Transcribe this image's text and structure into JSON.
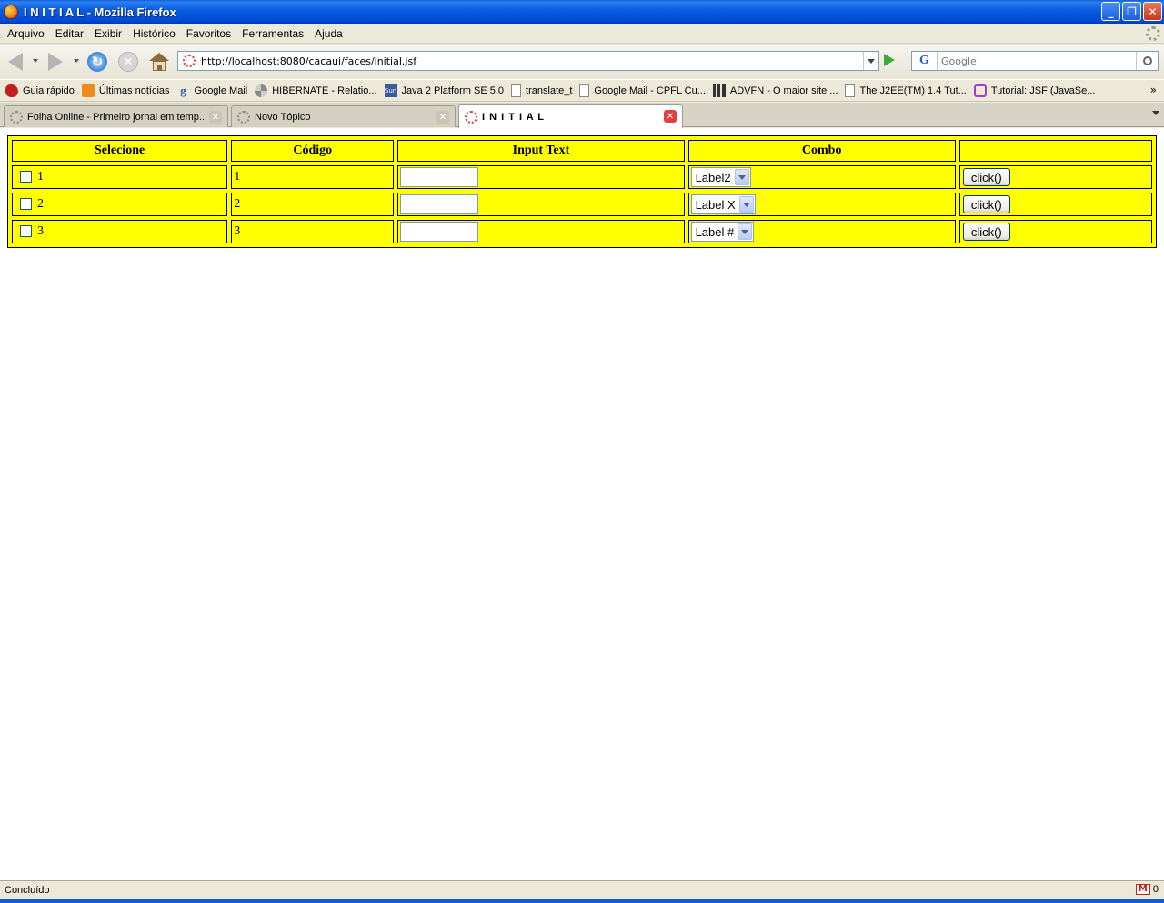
{
  "window": {
    "title": "I N I T I A L - Mozilla Firefox",
    "buttons": {
      "minimize": "_",
      "maximize": "❐",
      "close": "✕"
    }
  },
  "menu": {
    "items": [
      "Arquivo",
      "Editar",
      "Exibir",
      "Histórico",
      "Favoritos",
      "Ferramentas",
      "Ajuda"
    ]
  },
  "nav": {
    "url": "http://localhost:8080/cacaui/faces/initial.jsf",
    "search_placeholder": "Google",
    "search_engine": "G"
  },
  "bookmarks": [
    {
      "label": "Guia rápido",
      "icon": "red-hat-icon"
    },
    {
      "label": "Últimas notícias",
      "icon": "rss-icon"
    },
    {
      "label": "Google Mail",
      "icon": "google-icon"
    },
    {
      "label": "HIBERNATE - Relatio...",
      "icon": "hibernate-icon"
    },
    {
      "label": "Java 2 Platform SE 5.0",
      "icon": "sun-icon"
    },
    {
      "label": "translate_t",
      "icon": "page-icon"
    },
    {
      "label": "Google Mail - CPFL Cu...",
      "icon": "page-icon"
    },
    {
      "label": "ADVFN - O maior site ...",
      "icon": "chart-icon"
    },
    {
      "label": "The J2EE(TM) 1.4 Tut...",
      "icon": "page-icon"
    },
    {
      "label": "Tutorial: JSF (JavaSe...",
      "icon": "tutorial-icon"
    }
  ],
  "tabs": [
    {
      "label": "Folha Online - Primeiro jornal em temp...",
      "active": false
    },
    {
      "label": "Novo Tópico",
      "active": false
    },
    {
      "label": "I N I T I A L",
      "active": true
    }
  ],
  "table": {
    "headers": [
      "Selecione",
      "Código",
      "Input Text",
      "Combo",
      ""
    ],
    "rows": [
      {
        "select": "1",
        "codigo": "1",
        "input": "",
        "combo": "Label2",
        "button": "click()"
      },
      {
        "select": "2",
        "codigo": "2",
        "input": "",
        "combo": "Label X",
        "button": "click()"
      },
      {
        "select": "3",
        "codigo": "3",
        "input": "",
        "combo": "Label #",
        "button": "click()"
      }
    ]
  },
  "status": {
    "text": "Concluído",
    "gmail_count": "0"
  },
  "colors": {
    "table_background": "#ffff00",
    "titlebar": "#0a5fd8"
  }
}
